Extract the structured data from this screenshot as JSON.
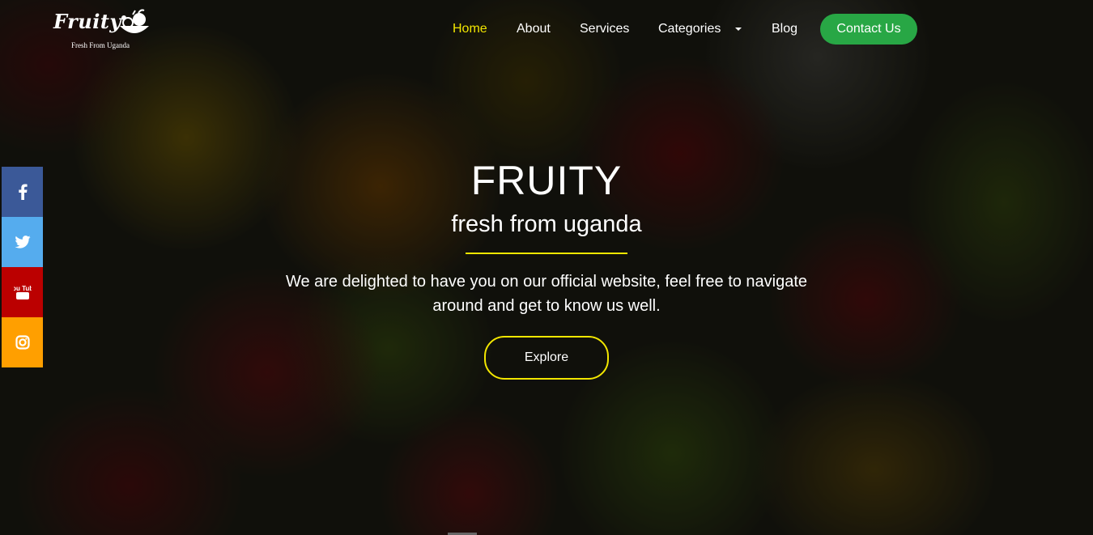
{
  "brand": {
    "name": "Fruity",
    "tagline": "Fresh From Uganda"
  },
  "nav": {
    "items": [
      {
        "label": "Home",
        "active": true
      },
      {
        "label": "About"
      },
      {
        "label": "Services"
      },
      {
        "label": "Categories",
        "dropdown": true
      },
      {
        "label": "Blog"
      }
    ],
    "contact_label": "Contact Us",
    "active_color": "#f2e600",
    "contact_color": "#28a745"
  },
  "social": [
    {
      "name": "facebook-icon",
      "color": "#3b5998"
    },
    {
      "name": "twitter-icon",
      "color": "#55acee"
    },
    {
      "name": "youtube-icon",
      "color": "#bb0000",
      "text": "You Tube"
    },
    {
      "name": "instagram-icon",
      "color": "#ff9f00"
    }
  ],
  "hero": {
    "title": "FRUITY",
    "subtitle": "fresh from uganda",
    "description": "We are delighted to have you on our official website, feel free to navigate around and get to know us well.",
    "button_label": "Explore",
    "accent_color": "#f2e600"
  }
}
